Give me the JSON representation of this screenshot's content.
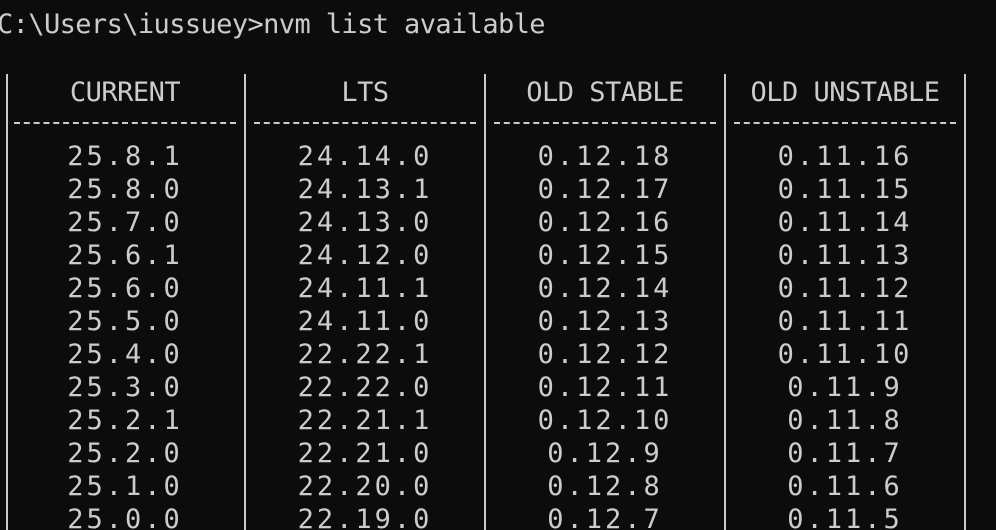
{
  "prompt": "C:\\Users\\iussuey>nvm list available",
  "columns": [
    {
      "header": "CURRENT",
      "values": [
        "25.8.1",
        "25.8.0",
        "25.7.0",
        "25.6.1",
        "25.6.0",
        "25.5.0",
        "25.4.0",
        "25.3.0",
        "25.2.1",
        "25.2.0",
        "25.1.0",
        "25.0.0"
      ]
    },
    {
      "header": "LTS",
      "values": [
        "24.14.0",
        "24.13.1",
        "24.13.0",
        "24.12.0",
        "24.11.1",
        "24.11.0",
        "22.22.1",
        "22.22.0",
        "22.21.1",
        "22.21.0",
        "22.20.0",
        "22.19.0"
      ]
    },
    {
      "header": "OLD STABLE",
      "values": [
        "0.12.18",
        "0.12.17",
        "0.12.16",
        "0.12.15",
        "0.12.14",
        "0.12.13",
        "0.12.12",
        "0.12.11",
        "0.12.10",
        "0.12.9",
        "0.12.8",
        "0.12.7"
      ]
    },
    {
      "header": "OLD UNSTABLE",
      "values": [
        "0.11.16",
        "0.11.15",
        "0.11.14",
        "0.11.13",
        "0.11.12",
        "0.11.11",
        "0.11.10",
        "0.11.9",
        "0.11.8",
        "0.11.7",
        "0.11.6",
        "0.11.5"
      ]
    }
  ],
  "colors": {
    "background": "#0c0c0c",
    "text": "#cccccc"
  }
}
